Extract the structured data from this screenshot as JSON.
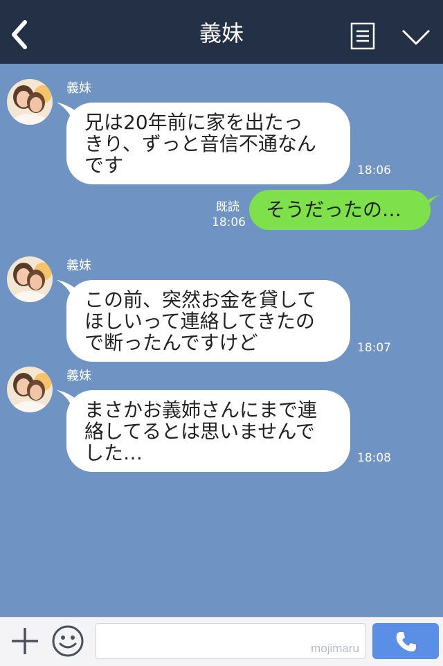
{
  "header": {
    "title": "義妹",
    "back_icon": "chevron-left-icon",
    "notes_icon": "notes-icon",
    "menu_icon": "chevron-down-icon",
    "bg_color": "#243046"
  },
  "chat": {
    "bg_color": "#6f93c2",
    "messages": [
      {
        "direction": "in",
        "sender": "義妹",
        "lines": [
          "兄は20年前に家を出たっ",
          "きり、ずっと音信不通なん",
          "です"
        ],
        "time": "18:06"
      },
      {
        "direction": "out",
        "lines": [
          "そうだったの…"
        ],
        "read_label": "既読",
        "time": "18:06"
      },
      {
        "direction": "in",
        "sender": "義妹",
        "lines": [
          "この前、突然お金を貸して",
          "ほしいって連絡してきたの",
          "で断ったんですけど"
        ],
        "time": "18:07"
      },
      {
        "direction": "in",
        "sender": "義妹",
        "lines": [
          "まさかお義姉さんにまで連",
          "絡してるとは思いませんで",
          "した…"
        ],
        "time": "18:08"
      }
    ]
  },
  "footer": {
    "plus_icon": "plus-icon",
    "emoji_icon": "smiley-icon",
    "input_value": "",
    "watermark": "mojimaru",
    "call_icon": "phone-icon",
    "call_color": "#5b8ee6"
  },
  "colors": {
    "incoming_bubble": "#ffffff",
    "outgoing_bubble": "#7ee04a"
  }
}
